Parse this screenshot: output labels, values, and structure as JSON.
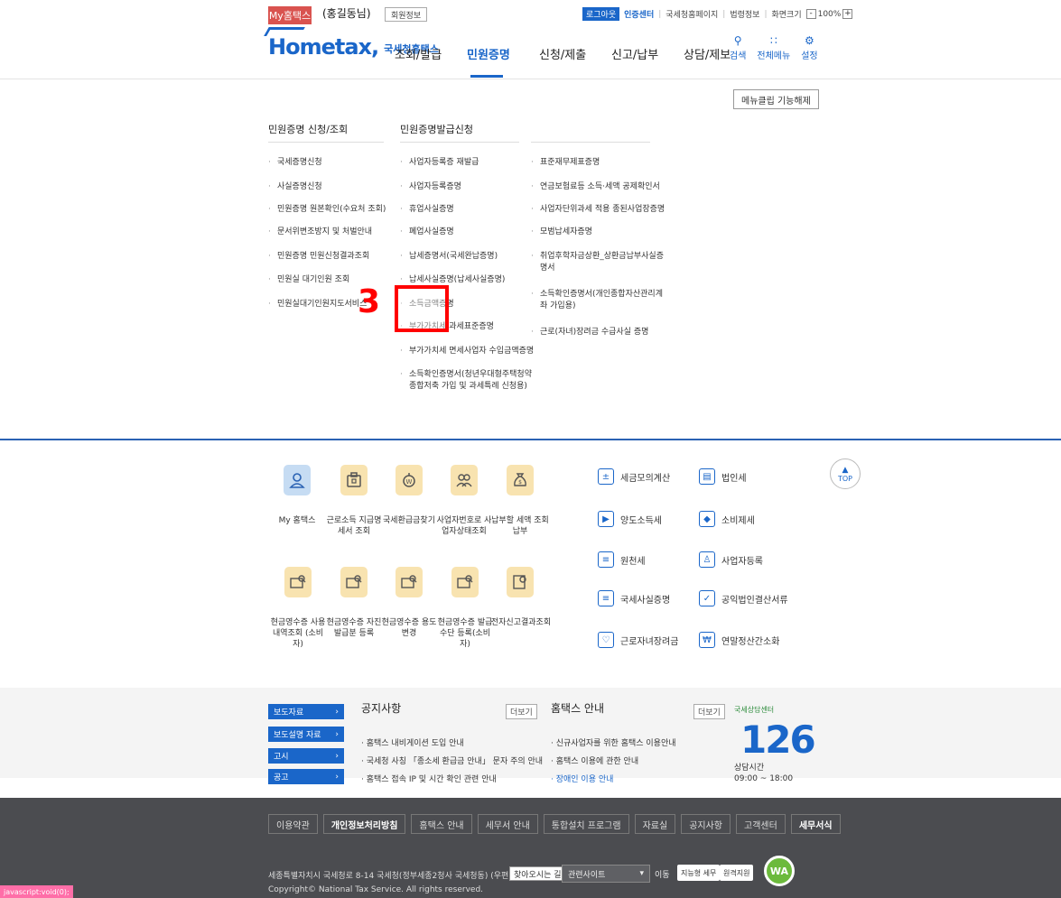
{
  "util": {
    "my_label": "My홈택스",
    "user": "(홍길동님)",
    "member_info": "회원정보",
    "logout": "로그아웃",
    "cert": "인증센터",
    "links": [
      "국세청홈페이지",
      "법령정보"
    ],
    "screen_size": "화면크기",
    "zoom": "100%"
  },
  "header": {
    "logo": "Hometax,",
    "logo_sub": "국세청홈택스",
    "gnb": [
      "조회/발급",
      "민원증명",
      "신청/제출",
      "신고/납부",
      "상담/제보"
    ],
    "icons": [
      {
        "label": "검색",
        "icon": "search-icon"
      },
      {
        "label": "전체메뉴",
        "icon": "grid-icon"
      },
      {
        "label": "설정",
        "icon": "gear-icon"
      }
    ]
  },
  "menu_clip": "메뉴클립 기능해제",
  "mega": {
    "col1_title": "민원증명 신청/조회",
    "col2_title": "민원증명발급신청",
    "col1": [
      "국세증명신청",
      "사실증명신청",
      "민원증명 원본확인(수요처 조회)",
      "문서위변조방지 및 처벌안내",
      "민원증명 민원신청결과조회",
      "민원실 대기인원 조회",
      "민원실대기인원지도서비스"
    ],
    "col2": [
      "사업자등록증 재발급",
      "사업자등록증명",
      "휴업사실증명",
      "폐업사실증명",
      "납세증명서(국세완납증명)",
      "납세사실증명(납세사실증명)",
      "소득금액증명",
      "부가가치세 과세표준증명",
      "부가가치세 면세사업자 수입금액증명",
      "소득확인증명서(청년우대형주택청약 종합저축 가입 및 과세특례 신청용)"
    ],
    "col3": [
      "표준재무제표증명",
      "연금보험료등 소득·세액 공제확인서",
      "사업자단위과세 적용 종된사업장증명",
      "모범납세자증명",
      "취업후학자금상환_상환금납부사실증명서",
      "소득확인증명서(개인종합자산관리계좌 가입용)",
      "근로(자녀)장려금 수급사실 증명"
    ],
    "step": "3"
  },
  "quick": {
    "row1": [
      {
        "label": "My 홈택스",
        "icon": "person-icon",
        "color": "blue"
      },
      {
        "label": "근로소득 지급명세서 조회",
        "icon": "wallet-icon",
        "color": "yellow"
      },
      {
        "label": "국세환급금찾기",
        "icon": "coin-icon",
        "color": "yellow"
      },
      {
        "label": "사업자번호로 사업자상태조회",
        "icon": "users-icon",
        "color": "yellow"
      },
      {
        "label": "납부할 세액 조회납부",
        "icon": "moneybag-icon",
        "color": "yellow"
      }
    ],
    "row2": [
      {
        "label": "현금영수증 사용내역조회 (소비자)",
        "icon": "receipt-search-icon"
      },
      {
        "label": "현금영수증 자진발급분 등록",
        "icon": "receipt-search-icon"
      },
      {
        "label": "현금영수증 용도변경",
        "icon": "receipt-search-icon"
      },
      {
        "label": "현금영수증 발급수단 등록(소비자)",
        "icon": "receipt-search-icon"
      },
      {
        "label": "전자신고결과조회",
        "icon": "doc-search-icon"
      }
    ]
  },
  "tax_links": {
    "left": [
      {
        "label": "세금모의계산",
        "icon": "calculator-icon"
      },
      {
        "label": "양도소득세",
        "icon": "truck-icon"
      },
      {
        "label": "원천세",
        "icon": "doc-icon"
      },
      {
        "label": "국세사실증명",
        "icon": "doc-icon"
      },
      {
        "label": "근로자녀장려금",
        "icon": "heart-icon"
      }
    ],
    "right": [
      {
        "label": "법인세",
        "icon": "building-icon"
      },
      {
        "label": "소비제세",
        "icon": "diamond-icon"
      },
      {
        "label": "사업자등록",
        "icon": "person-icon"
      },
      {
        "label": "공익법인결산서류",
        "icon": "check-doc-icon"
      },
      {
        "label": "연말정산간소화",
        "icon": "tax-icon"
      }
    ]
  },
  "top_btn": "TOP",
  "notice": {
    "tabs": [
      "보도자료",
      "보도설명 자료",
      "고시",
      "공고"
    ],
    "title": "공지사항",
    "more": "더보기",
    "items": [
      "홈택스 내비게이션 도입 안내",
      "국세청 사칭 「종소세 환급금 안내」 문자 주의 안내",
      "홈택스 접속 IP 및 시간 확인 관련 안내"
    ],
    "guide_title": "홈택스 안내",
    "guide_more": "더보기",
    "guide_items": [
      "신규사업자를 위한 홈택스 이용안내",
      "홈택스 이용에 관한 안내",
      "장애인 이용 안내"
    ],
    "center_title": "국세상담센터",
    "center_num": "126",
    "hours_label": "상담시간",
    "hours": "09:00 ~ 18:00"
  },
  "footer": {
    "nav": [
      "이용약관",
      "개인정보처리방침",
      "홈택스 안내",
      "세무서 안내",
      "통합설치 프로그램",
      "자료실",
      "공지사항",
      "고객센터",
      "세무서식"
    ],
    "address": "세종특별자치시 국세청로 8-14 국세청(정부세종2청사 국세청동) (우편번호) 30128",
    "find": "찾아오시는 길",
    "related": "관련사이트",
    "go": "이동",
    "badge1": "지능형 세무",
    "badge2": "원격지원",
    "wa": "WA",
    "copyright": "Copyright© National Tax Service. All rights reserved.",
    "status": "javascript:void(0);"
  }
}
